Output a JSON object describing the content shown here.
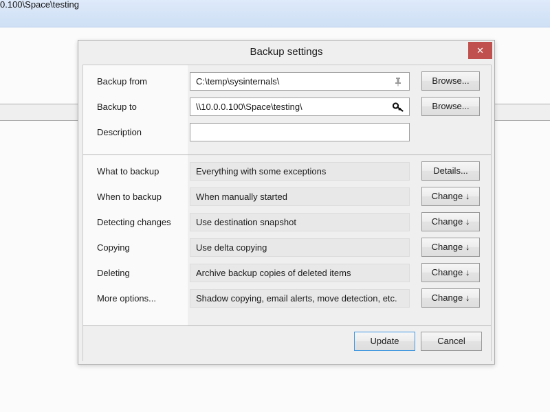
{
  "background_window": {
    "title_text": "0.100\\Space\\testing"
  },
  "dialog": {
    "title": "Backup settings",
    "close_icon": "close-icon",
    "close_color": "#c0504d",
    "accent_color": "#3f96e0",
    "top_section": [
      {
        "label": "Backup from",
        "value": "C:\\temp\\sysinternals\\",
        "field_type": "editable",
        "icon": "pushpin-icon",
        "button": "Browse..."
      },
      {
        "label": "Backup to",
        "value": "\\\\10.0.0.100\\Space\\testing\\",
        "field_type": "editable",
        "icon": "key-icon",
        "button": "Browse..."
      },
      {
        "label": "Description",
        "value": "",
        "field_type": "editable",
        "icon": "",
        "button": ""
      }
    ],
    "main_section": [
      {
        "label": "What to backup",
        "value": "Everything with some exceptions",
        "field_type": "readonly",
        "button": "Details..."
      },
      {
        "label": "When to backup",
        "value": "When manually started",
        "field_type": "readonly",
        "button": "Change ↓"
      },
      {
        "label": "Detecting changes",
        "value": "Use destination snapshot",
        "field_type": "readonly",
        "button": "Change ↓"
      },
      {
        "label": "Copying",
        "value": "Use delta copying",
        "field_type": "readonly",
        "button": "Change ↓"
      },
      {
        "label": "Deleting",
        "value": "Archive backup copies of deleted items",
        "field_type": "readonly",
        "button": "Change ↓"
      },
      {
        "label": "More options...",
        "value": "Shadow copying, email alerts, move detection, etc.",
        "field_type": "readonly",
        "button": "Change ↓"
      }
    ],
    "footer": {
      "update_label": "Update",
      "cancel_label": "Cancel"
    }
  }
}
